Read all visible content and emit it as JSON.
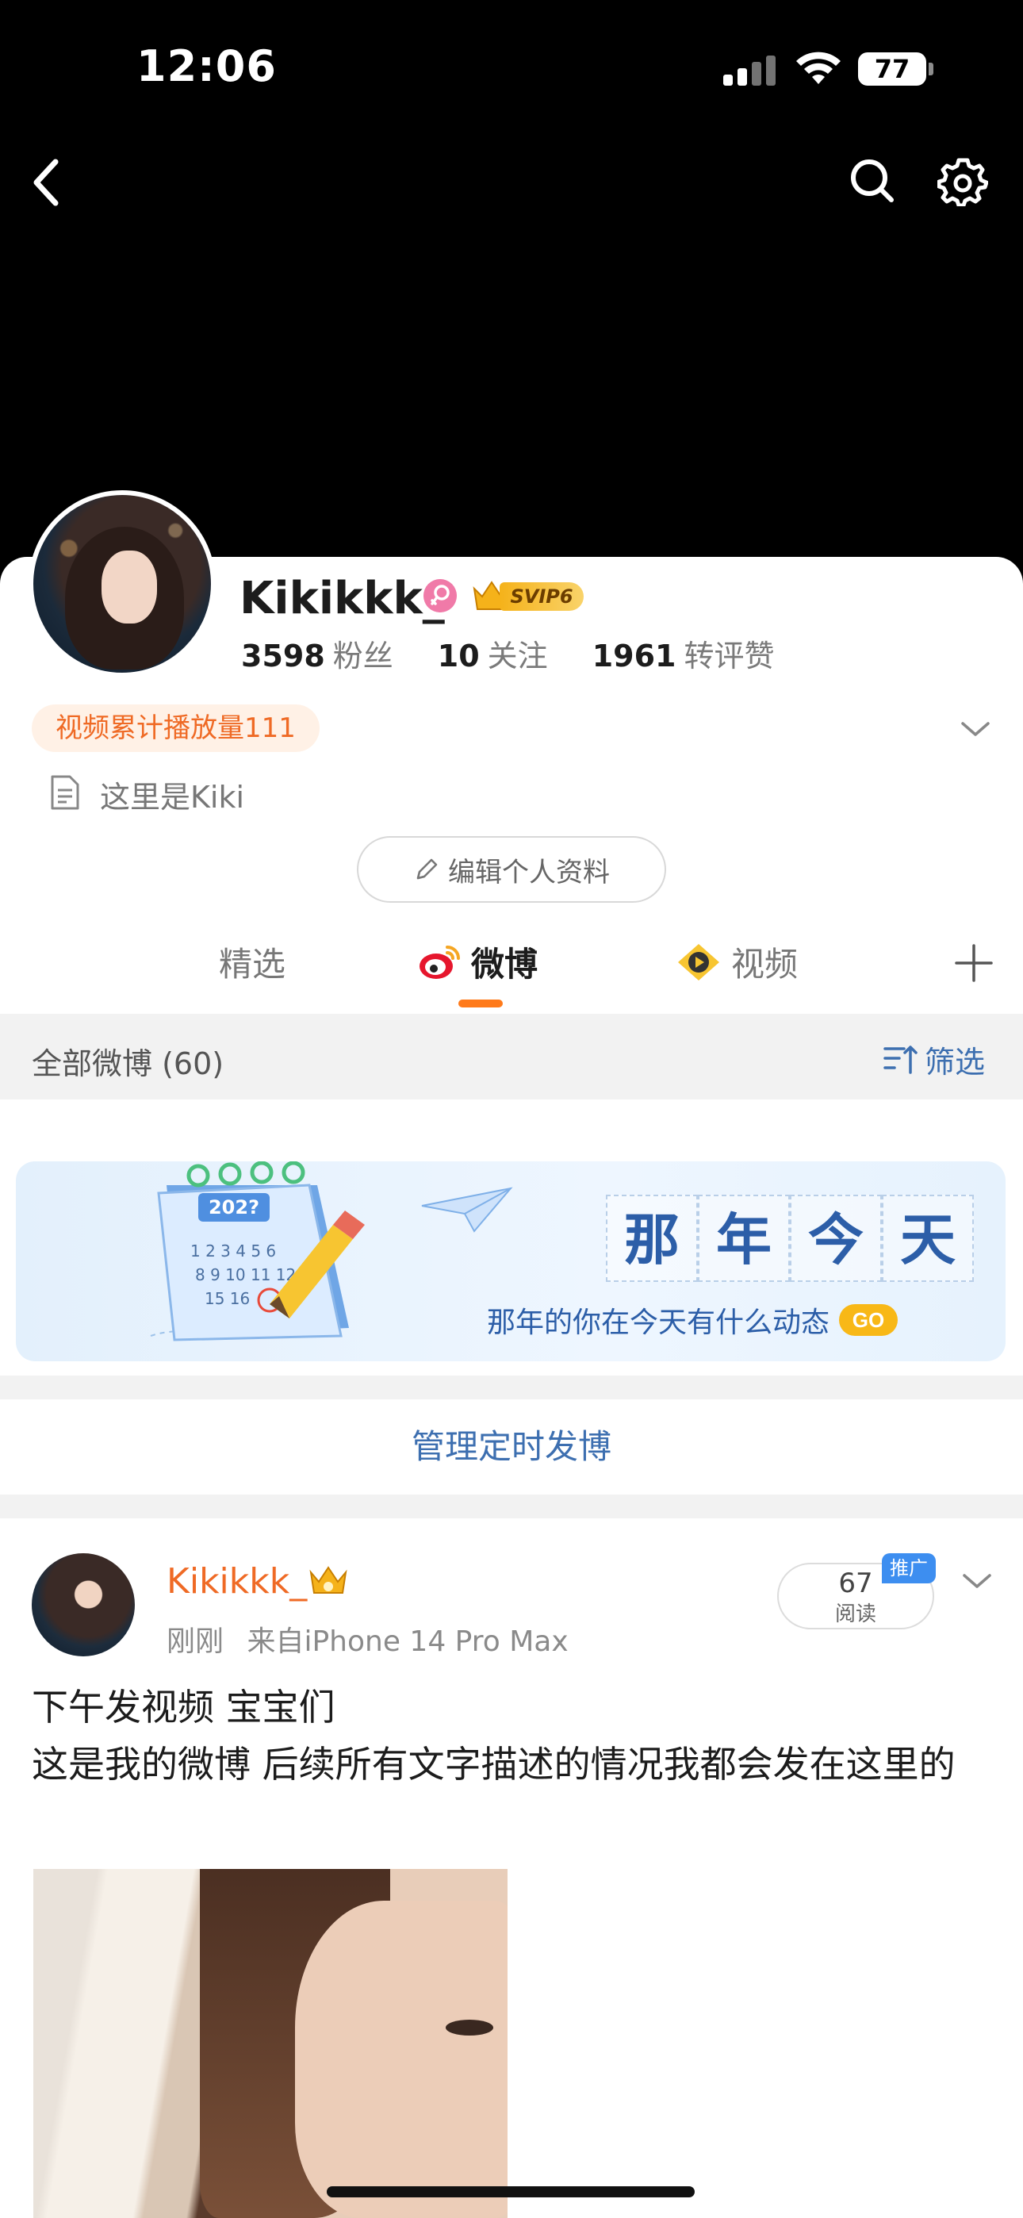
{
  "status_bar": {
    "time": "12:06",
    "battery": "77"
  },
  "profile": {
    "username": "Kikikkk_",
    "svip_label": "SVIP6",
    "stats": [
      {
        "num": "3598",
        "label": "粉丝"
      },
      {
        "num": "10",
        "label": "关注"
      },
      {
        "num": "1961",
        "label": "转评赞"
      }
    ],
    "video_pill": "视频累计播放量111",
    "bio": "这里是Kiki",
    "edit_label": "编辑个人资料"
  },
  "tabs": [
    {
      "label": "精选"
    },
    {
      "label": "微博"
    },
    {
      "label": "视频"
    }
  ],
  "filter": {
    "title": "全部微博 (60)",
    "button": "筛选"
  },
  "banner": {
    "title_chars": [
      "那",
      "年",
      "今",
      "天"
    ],
    "subtitle": "那年的你在今天有什么动态",
    "go": "GO",
    "calendar_year": "202?"
  },
  "manage_label": "管理定时发博",
  "post": {
    "author": "Kikikkk_",
    "time": "刚刚",
    "source": "来自iPhone 14 Pro Max",
    "reads": "67",
    "reads_label": "阅读",
    "promo_tag": "推广",
    "lines": [
      "下午发视频 宝宝们",
      "这是我的微博 后续所有文字描述的情况我都会发在这里的"
    ]
  },
  "colors": {
    "accent": "#ef6a25",
    "link": "#3d6fb0",
    "tab_indicator": "#ff7a1a"
  }
}
